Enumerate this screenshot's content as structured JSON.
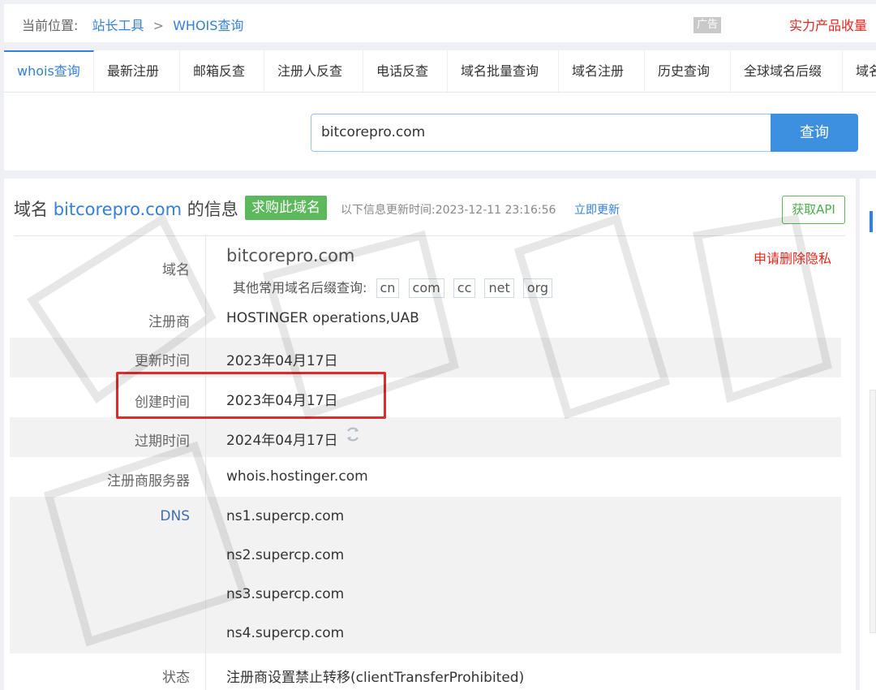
{
  "breadcrumb": {
    "prefix": "当前位置:",
    "items": [
      "站长工具",
      "WHOIS查询"
    ],
    "separator": ">"
  },
  "ad_badge": "广告",
  "promo": "实力产品收量",
  "tabs": [
    {
      "label": "whois查询",
      "active": true
    },
    {
      "label": "最新注册"
    },
    {
      "label": "邮箱反查"
    },
    {
      "label": "注册人反查"
    },
    {
      "label": "电话反查"
    },
    {
      "label": "域名批量查询"
    },
    {
      "label": "域名注册"
    },
    {
      "label": "历史查询"
    },
    {
      "label": "全球域名后缀"
    },
    {
      "label": "域名"
    }
  ],
  "search": {
    "value": "bitcorepro.com",
    "button_label": "查询"
  },
  "info": {
    "title_prefix": "域名",
    "title_domain": "bitcorepro.com",
    "title_suffix": "的信息",
    "buy_label": "求购此域名",
    "updated_text": "以下信息更新时间:2023-12-11 23:16:56",
    "update_now": "立即更新",
    "api_label": "获取API"
  },
  "whois": {
    "domain_label": "域名",
    "domain_value": "bitcorepro.com",
    "privacy_link": "申请删除隐私",
    "suffix_prompt": "其他常用域名后缀查询:",
    "suffixes": [
      "cn",
      "com",
      "cc",
      "net",
      "org"
    ],
    "registrar_label": "注册商",
    "registrar_value": "HOSTINGER operations,UAB",
    "updated_label": "更新时间",
    "updated_value": "2023年04月17日",
    "created_label": "创建时间",
    "created_value": "2023年04月17日",
    "expires_label": "过期时间",
    "expires_value": "2024年04月17日",
    "server_label": "注册商服务器",
    "server_value": "whois.hostinger.com",
    "dns_label": "DNS",
    "dns": [
      "ns1.supercp.com",
      "ns2.supercp.com",
      "ns3.supercp.com",
      "ns4.supercp.com"
    ],
    "status_label": "状态",
    "status_value": "注册商设置禁止转移(clientTransferProhibited)"
  },
  "colors": {
    "accent": "#3580d8",
    "buy_green": "#5cb85c",
    "alert_red": "#e12a2a"
  }
}
